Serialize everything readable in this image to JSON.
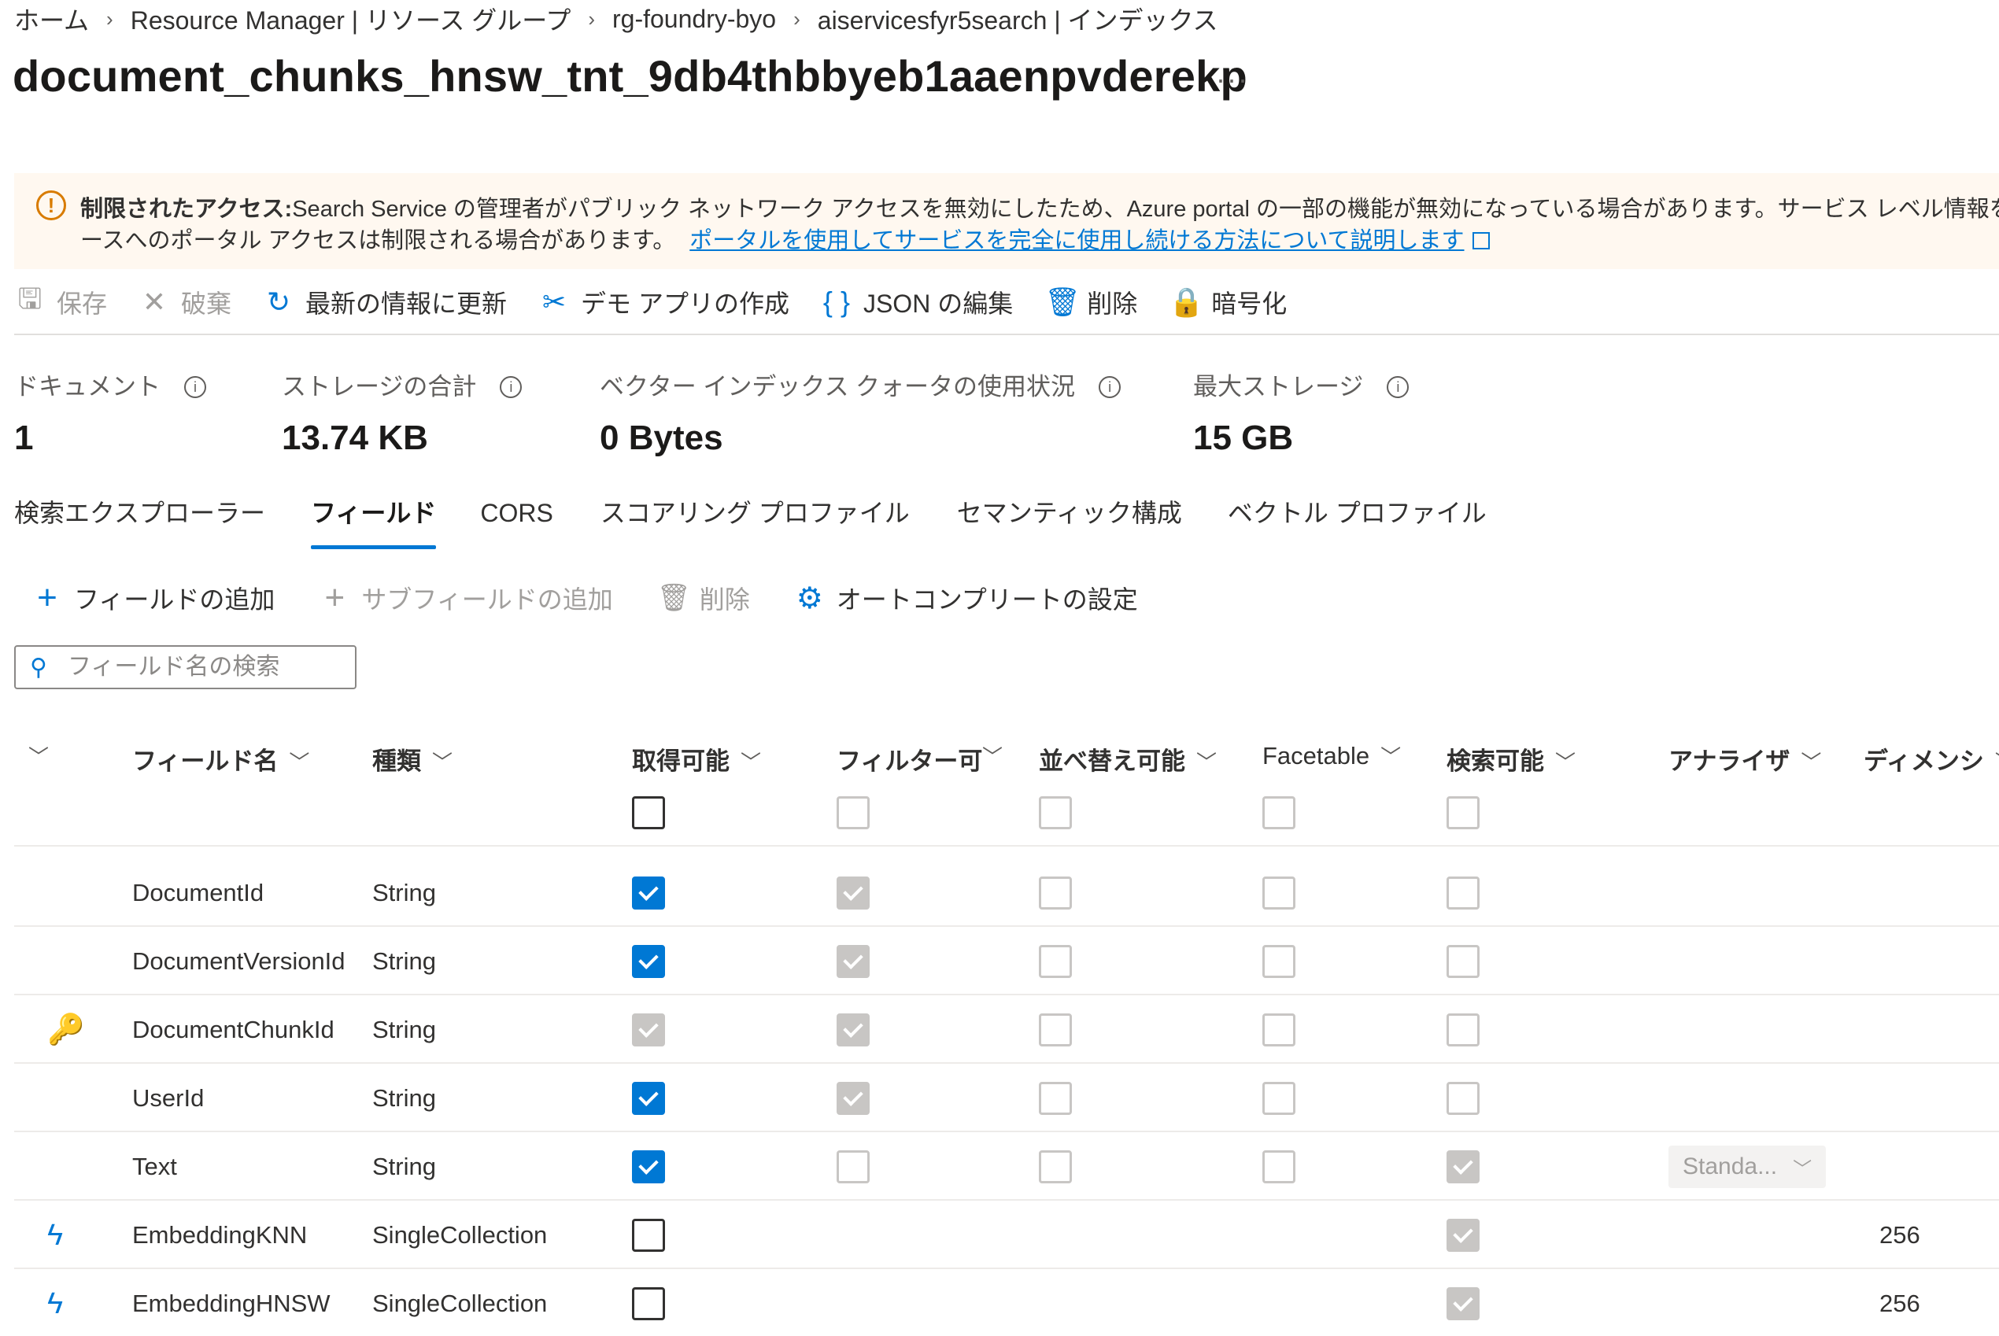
{
  "breadcrumb": [
    "ホーム",
    "Resource Manager | リソース グループ",
    "rg-foundry-byo",
    "aiservicesfyr5search | インデックス"
  ],
  "title": "document_chunks_hnsw_tnt_9db4thbbyeb1aaenpvderekp",
  "more": "···",
  "banner": {
    "bold": "制限されたアクセス:",
    "text1": "Search Service の管理者がパブリック ネットワーク アクセスを無効にしたため、Azure portal の一部の機能が無効になっている場合があります。サービス レベル情報を表示",
    "text2": "ースへのポータル アクセスは制限される場合があります。",
    "link": "ポータルを使用してサービスを完全に使用し続ける方法について説明します"
  },
  "commands": [
    {
      "label": "保存",
      "icon": "save-icon",
      "glyph": "🖫",
      "enabled": false
    },
    {
      "label": "破棄",
      "icon": "discard-icon",
      "glyph": "✕",
      "enabled": false
    },
    {
      "label": "最新の情報に更新",
      "icon": "refresh-icon",
      "glyph": "↻",
      "enabled": true
    },
    {
      "label": "デモ アプリの作成",
      "icon": "demo-app-icon",
      "glyph": "✂",
      "enabled": true
    },
    {
      "label": "JSON の編集",
      "icon": "json-icon",
      "glyph": "{ }",
      "enabled": true
    },
    {
      "label": "削除",
      "icon": "delete-icon",
      "glyph": "🗑",
      "enabled": true
    },
    {
      "label": "暗号化",
      "icon": "lock-icon",
      "glyph": "🔒",
      "enabled": true
    }
  ],
  "stats": [
    {
      "label": "ドキュメント",
      "value": "1"
    },
    {
      "label": "ストレージの合計",
      "value": "13.74 KB"
    },
    {
      "label": "ベクター インデックス クォータの使用状況",
      "value": "0 Bytes"
    },
    {
      "label": "最大ストレージ",
      "value": "15 GB"
    }
  ],
  "tabs": [
    "検索エクスプローラー",
    "フィールド",
    "CORS",
    "スコアリング プロファイル",
    "セマンティック構成",
    "ベクトル プロファイル"
  ],
  "active_tab": "フィールド",
  "field_toolbar": [
    {
      "label": "フィールドの追加",
      "enabled": true
    },
    {
      "label": "サブフィールドの追加",
      "enabled": false
    },
    {
      "label": "削除",
      "enabled": false
    },
    {
      "label": "オートコンプリートの設定",
      "enabled": true
    }
  ],
  "search": {
    "placeholder": "フィールド名の検索"
  },
  "columns": [
    "フィールド名",
    "種類",
    "取得可能",
    "フィルター可",
    "並べ替え可能",
    "Facetable",
    "検索可能",
    "アナライザ",
    "ディメンション"
  ],
  "column_header_visible": [
    "フィールド名",
    "種類",
    "取得可能",
    "フィルター可",
    "並べ替え可能",
    "Facetable",
    "検索可能",
    "アナライザ",
    "ディメンシ"
  ],
  "rows": [
    {
      "icon": "",
      "name": "DocumentId",
      "type": "String",
      "retrievable": "checked",
      "filterable": "dis-checked",
      "sortable": "dis",
      "facetable": "dis",
      "searchable": "dis",
      "analyzer": "",
      "dimensions": ""
    },
    {
      "icon": "",
      "name": "DocumentVersionId",
      "type": "String",
      "retrievable": "checked",
      "filterable": "dis-checked",
      "sortable": "dis",
      "facetable": "dis",
      "searchable": "dis",
      "analyzer": "",
      "dimensions": ""
    },
    {
      "icon": "key-icon",
      "name": "DocumentChunkId",
      "type": "String",
      "retrievable": "dis-checked",
      "filterable": "dis-checked",
      "sortable": "dis",
      "facetable": "dis",
      "searchable": "dis",
      "analyzer": "",
      "dimensions": ""
    },
    {
      "icon": "",
      "name": "UserId",
      "type": "String",
      "retrievable": "checked",
      "filterable": "dis-checked",
      "sortable": "dis",
      "facetable": "dis",
      "searchable": "dis",
      "analyzer": "",
      "dimensions": ""
    },
    {
      "icon": "",
      "name": "Text",
      "type": "String",
      "retrievable": "checked",
      "filterable": "dis",
      "sortable": "dis",
      "facetable": "dis",
      "searchable": "dis-checked",
      "analyzer": "Standa...",
      "dimensions": ""
    },
    {
      "icon": "vector-icon",
      "name": "EmbeddingKNN",
      "type": "SingleCollection",
      "retrievable": "unchecked",
      "filterable": "",
      "sortable": "",
      "facetable": "",
      "searchable": "dis-checked",
      "analyzer": "",
      "dimensions": "256"
    },
    {
      "icon": "vector-icon",
      "name": "EmbeddingHNSW",
      "type": "SingleCollection",
      "retrievable": "unchecked",
      "filterable": "",
      "sortable": "",
      "facetable": "",
      "searchable": "dis-checked",
      "analyzer": "",
      "dimensions": "256"
    }
  ],
  "colors": {
    "accent": "#0078d4",
    "warning": "#d87b00",
    "banner_bg": "#fff8f0"
  }
}
